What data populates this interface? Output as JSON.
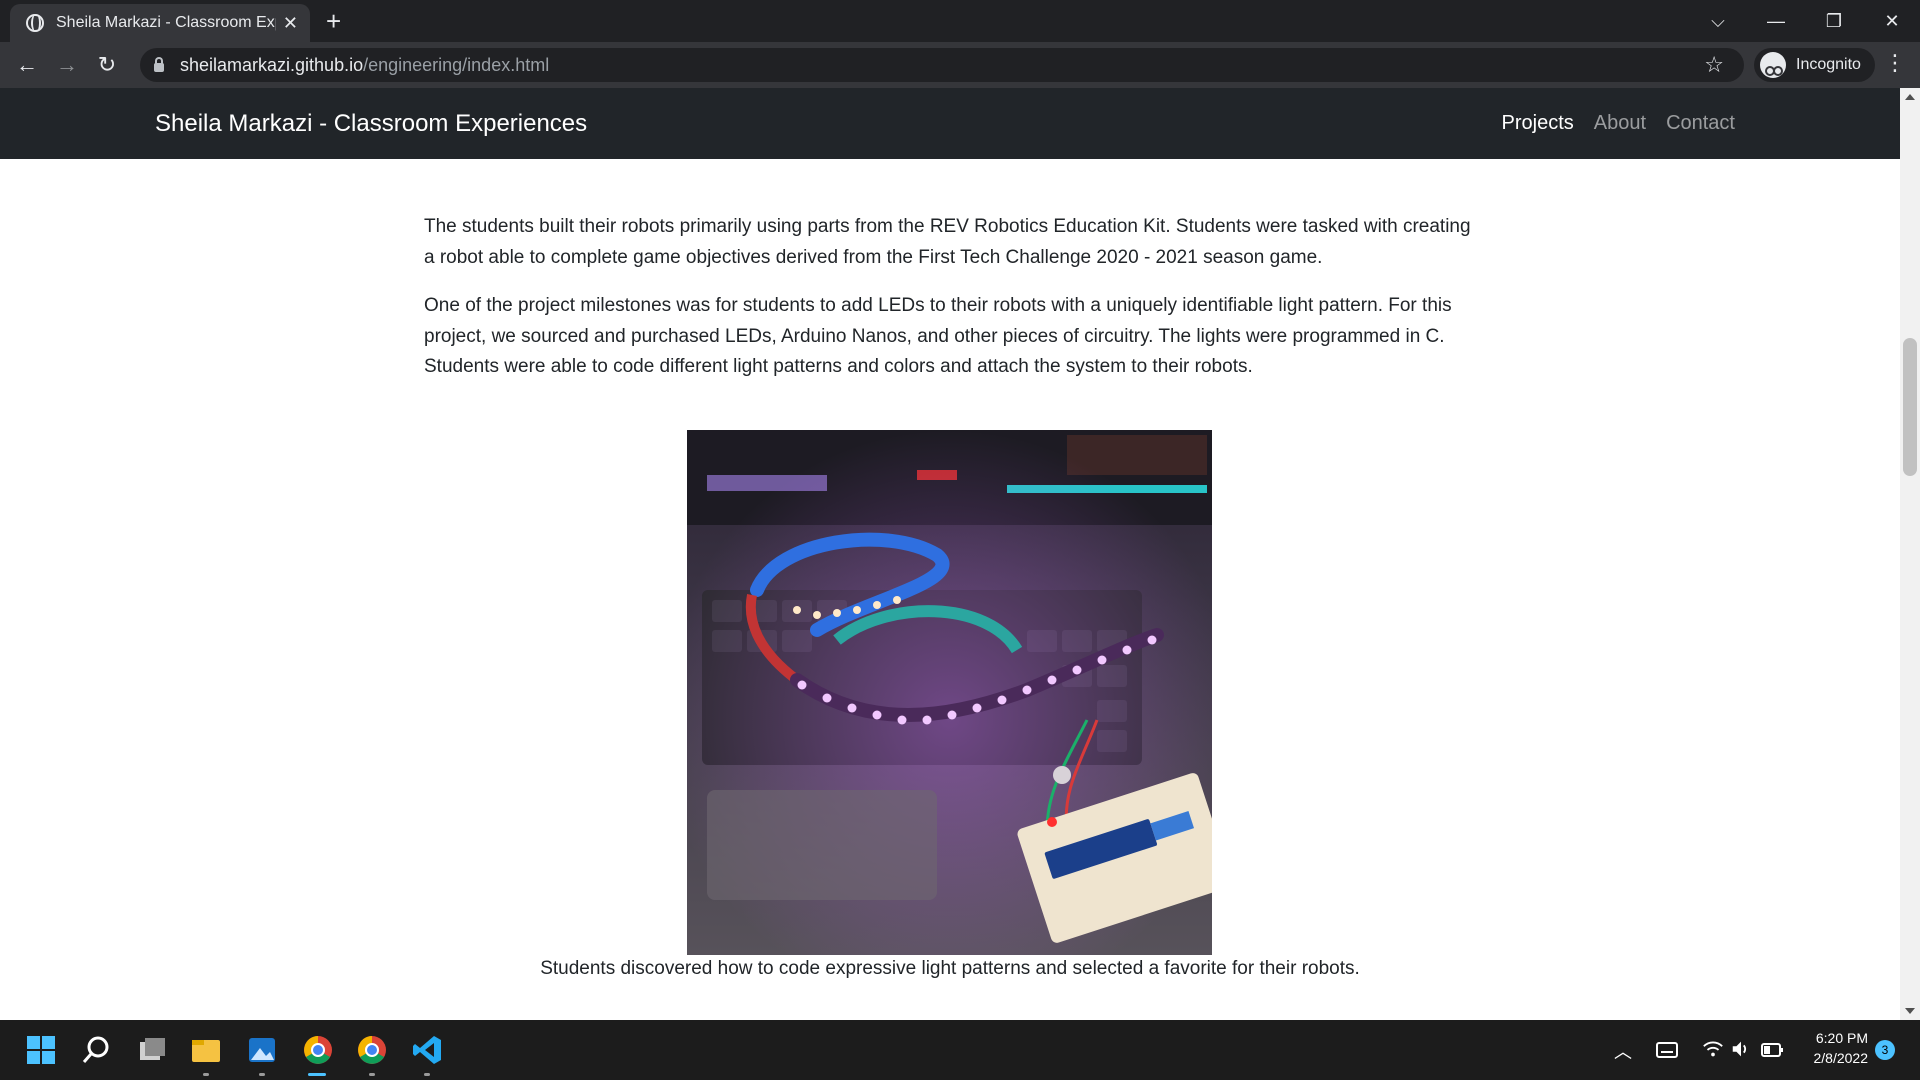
{
  "browser": {
    "tab_title": "Sheila Markazi - Classroom Experi",
    "tab_close": "✕",
    "new_tab": "+",
    "url_host": "sheilamarkazi.github.io",
    "url_path": "/engineering/index.html",
    "incognito_label": "Incognito",
    "window": {
      "tab_search": "⌵",
      "minimize": "—",
      "restore": "❐",
      "close": "✕"
    }
  },
  "site": {
    "brand": "Sheila Markazi - Classroom Experiences",
    "nav": [
      {
        "label": "Projects",
        "active": true
      },
      {
        "label": "About",
        "active": false
      },
      {
        "label": "Contact",
        "active": false
      }
    ]
  },
  "content": {
    "paragraphs": [
      "The students built their robots primarily using parts from the REV Robotics Education Kit. Students were tasked with creating a robot able to complete game objectives derived from the First Tech Challenge 2020 - 2021 season game.",
      "One of the project milestones was for students to add LEDs to their robots with a uniquely identifiable light pattern. For this project, we sourced and purchased LEDs, Arduino Nanos, and other pieces of circuitry. The lights were programmed in C. Students were able to code different light patterns and colors and attach the system to their robots."
    ],
    "caption": "Students discovered how to code expressive light patterns and selected a favorite for their robots."
  },
  "taskbar": {
    "time": "6:20 PM",
    "date": "2/8/2022",
    "notifications": "3",
    "icons": [
      "windows-start-icon",
      "search-icon",
      "task-view-icon",
      "file-explorer-icon",
      "photos-icon",
      "chrome-icon",
      "chrome-profile-icon",
      "vscode-icon"
    ]
  },
  "colors": {
    "chrome_dark": "#202124",
    "chrome_toolbar": "#35363a",
    "site_nav": "#212529",
    "taskbar": "#1c1c1c",
    "accent": "#4cc2ff"
  }
}
